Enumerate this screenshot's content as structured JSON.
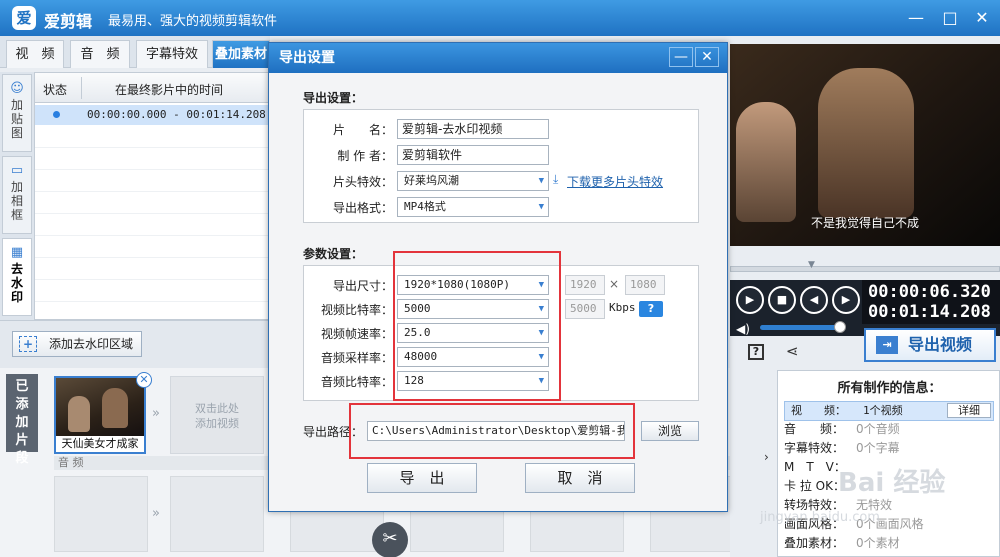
{
  "app": {
    "logo": "爱",
    "name": "爱剪辑",
    "slogan": "最易用、强大的视频剪辑软件"
  },
  "tabs": [
    "视　频",
    "音　频",
    "字幕特效",
    "叠加素材"
  ],
  "active_tab": "叠加素材",
  "sidetabs": [
    "加贴图",
    "加相框",
    "去水印"
  ],
  "table": {
    "headers": [
      "状态",
      "在最终影片中的时间"
    ],
    "rows": [
      {
        "time": "00:00:00.000 - 00:01:14.208"
      }
    ]
  },
  "add_watermark_button": "添加去水印区域",
  "clips": {
    "label": "已添加片段",
    "thumb_caption": "天仙美女才成家",
    "placeholder_text": "双击此处\n添加视频",
    "audio_label": "音 频"
  },
  "preview": {
    "subtitle": "不是我觉得自己不成",
    "time_current": "00:00:06.320",
    "time_total": "00:01:14.208"
  },
  "export_video_button": "导出视频",
  "info_panel": {
    "title": "所有制作的信息：",
    "detail_button": "详细",
    "rows": [
      {
        "key": "视　　频：",
        "value": "1个视频"
      },
      {
        "key": "音　　频：",
        "value": "0个音频"
      },
      {
        "key": "字幕特效：",
        "value": "0个字幕"
      },
      {
        "key": "M　T　V：",
        "value": ""
      },
      {
        "key": "卡 拉 OK：",
        "value": ""
      },
      {
        "key": "转场特效：",
        "value": "无特效"
      },
      {
        "key": "画面风格：",
        "value": "0个画面风格"
      },
      {
        "key": "叠加素材：",
        "value": "0个素材"
      }
    ]
  },
  "watermark": "Bai 经验",
  "watermark_sub": "jingyan.baidu.com",
  "modal": {
    "title": "导出设置",
    "section_export": "导出设置：",
    "section_params": "参数设置：",
    "fields": {
      "title_label": "片　　名：",
      "title_value": "爱剪辑-去水印视频",
      "author_label": "制 作 者：",
      "author_value": "爱剪辑软件",
      "intro_label": "片头特效：",
      "intro_value": "好莱坞风潮",
      "format_label": "导出格式：",
      "format_value": "MP4格式",
      "download_link": "下载更多片头特效"
    },
    "params": {
      "size_label": "导出尺寸：",
      "size_value": "1920*1080(1080P)",
      "size_w": "1920",
      "size_h": "1080",
      "size_x": "×",
      "vbitrate_label": "视频比特率：",
      "vbitrate_value": "5000",
      "vbitrate_box": "5000",
      "kbps": "Kbps",
      "fps_label": "视频帧速率：",
      "fps_value": "25.0",
      "asample_label": "音频采样率：",
      "asample_value": "48000",
      "abitrate_label": "音频比特率：",
      "abitrate_value": "128"
    },
    "path_label": "导出路径：",
    "path_value": "C:\\Users\\Administrator\\Desktop\\爱剪辑-我的视",
    "browse_button": "浏览",
    "export_button": "导　出",
    "cancel_button": "取　消"
  },
  "colors": {
    "accent": "#1f72c3",
    "highlight_red": "#e3343b"
  }
}
